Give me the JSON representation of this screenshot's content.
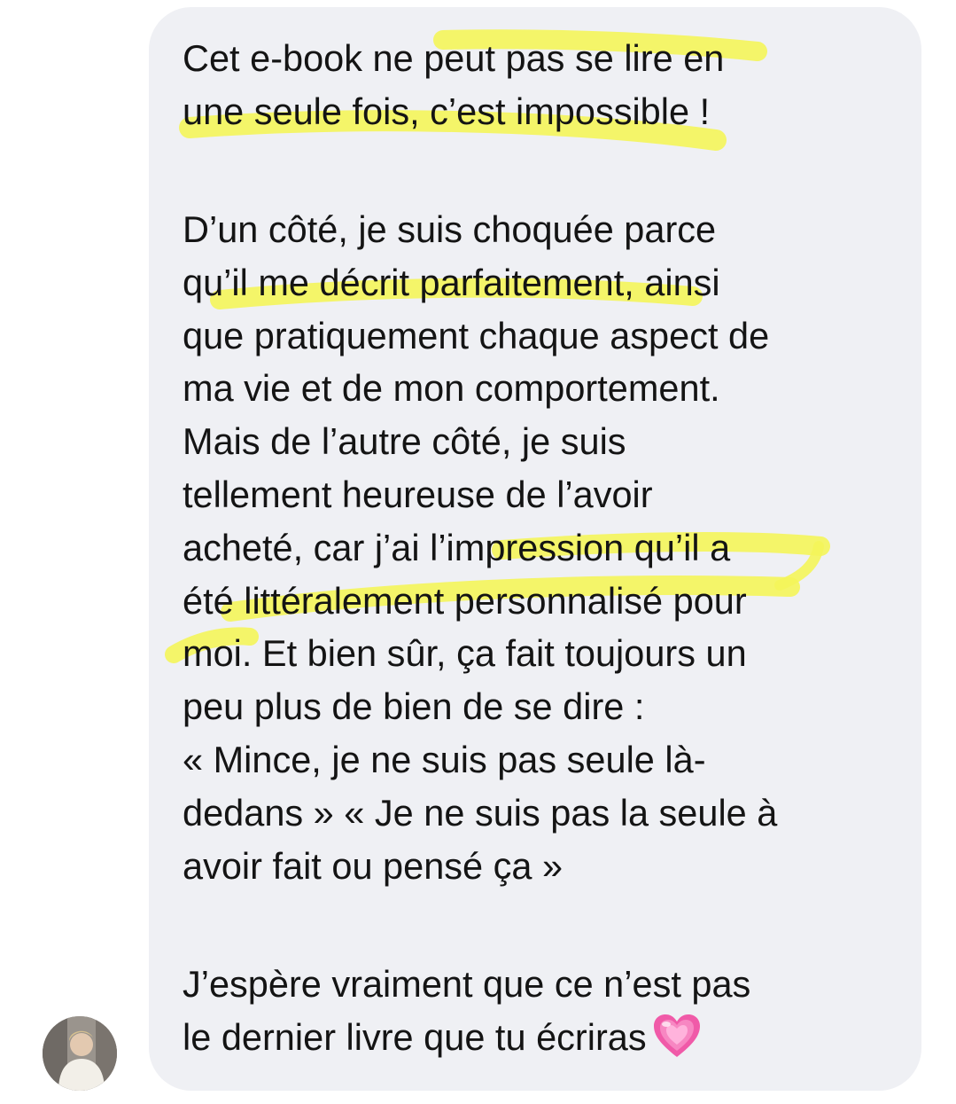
{
  "message": {
    "paragraph1": [
      "Cet e-book ne peut pas se lire en",
      "une seule fois, c’est impossible !"
    ],
    "paragraph2": [
      "D’un côté, je suis choquée parce",
      "qu’il me décrit parfaitement, ainsi",
      "que pratiquement chaque aspect de",
      "ma vie et de mon comportement.",
      "Mais de l’autre côté, je suis",
      "tellement heureuse de l’avoir",
      "acheté, car j’ai l’impression qu’il a",
      "été littéralement personnalisé pour",
      "moi. Et bien sûr, ça fait toujours un",
      "peu plus de bien de se dire :",
      "« Mince, je ne suis pas seule là-",
      "dedans » « Je ne suis pas la seule à",
      "avoir fait ou pensé ça »"
    ],
    "paragraph3": [
      "J’espère vraiment que ce n’est pas",
      "le dernier livre que tu écriras"
    ]
  },
  "highlight_color": "#f4f55a",
  "bubble_color": "#eff0f4",
  "icons": {
    "heart": "growing-heart-emoji",
    "avatar": "sender-avatar"
  }
}
